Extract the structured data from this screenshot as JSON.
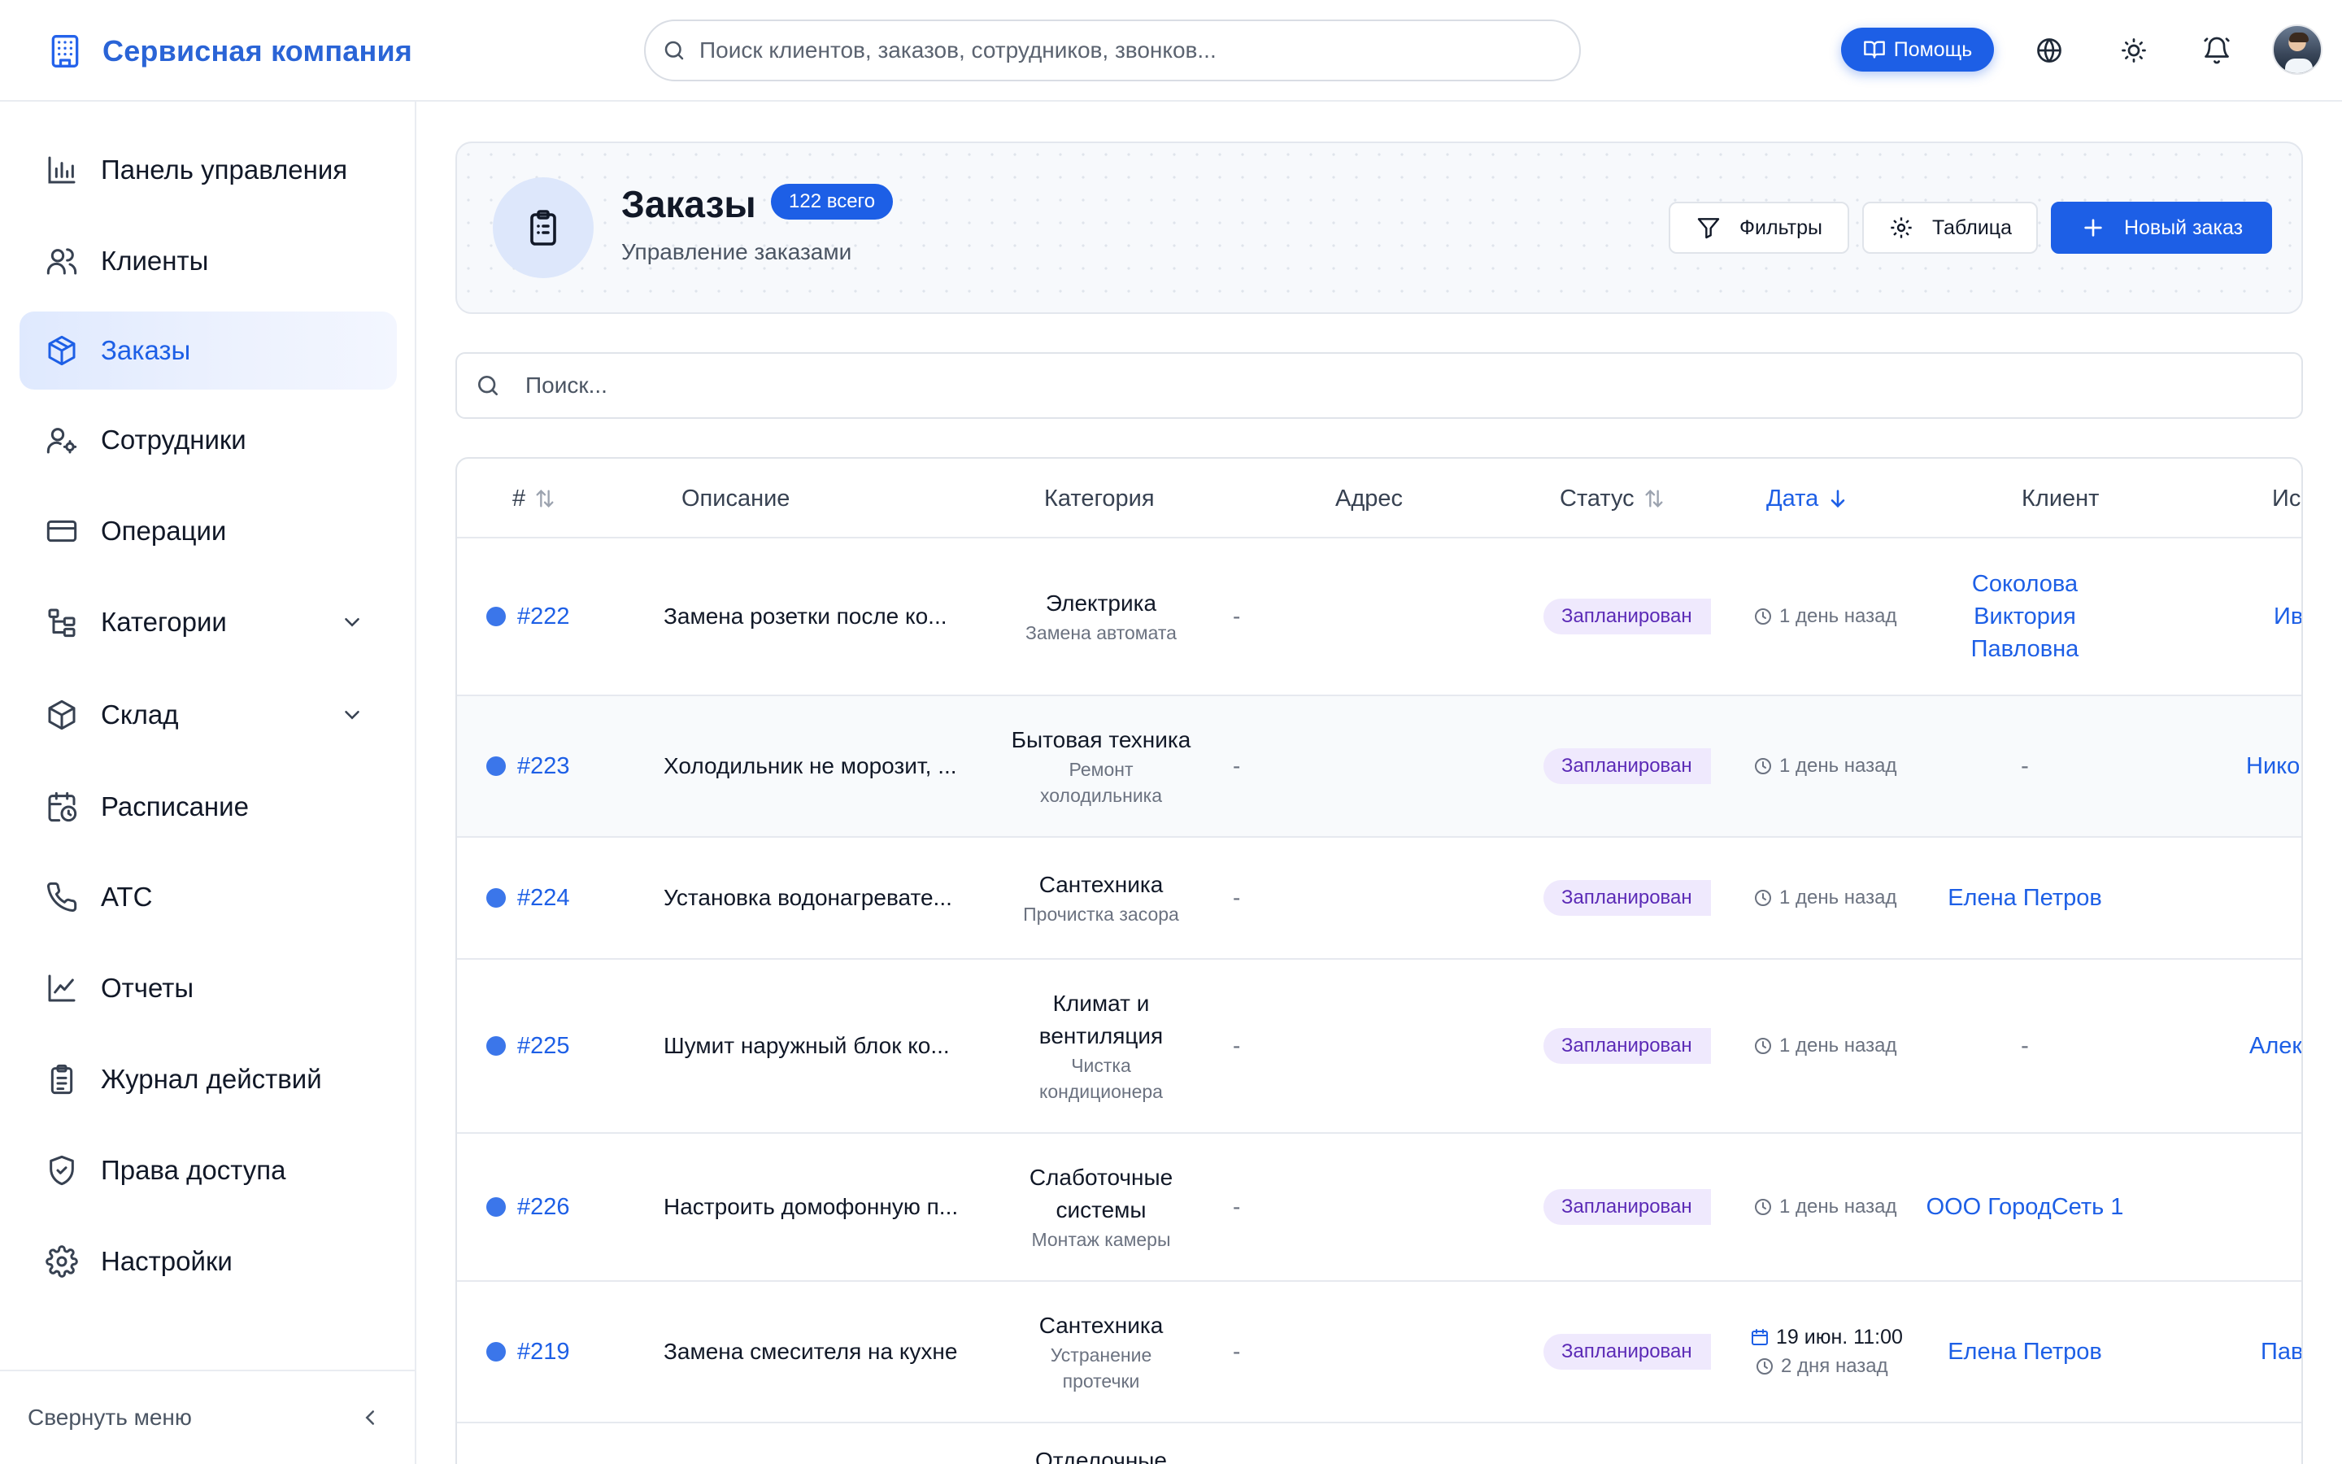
{
  "app": {
    "brand": "Сервисная компания",
    "search_placeholder": "Поиск клиентов, заказов, сотрудников, звонков...",
    "help_label": "Помощь",
    "accent": "#1d5fe6"
  },
  "sidebar": {
    "items": [
      {
        "label": "Панель управления",
        "icon": "bar-chart-icon"
      },
      {
        "label": "Клиенты",
        "icon": "users-icon"
      },
      {
        "label": "Заказы",
        "icon": "package-icon",
        "active": true
      },
      {
        "label": "Сотрудники",
        "icon": "user-cog-icon"
      },
      {
        "label": "Операции",
        "icon": "credit-card-icon"
      },
      {
        "label": "Категории",
        "icon": "hierarchy-icon",
        "expandable": true
      },
      {
        "label": "Склад",
        "icon": "box-icon",
        "expandable": true
      },
      {
        "label": "Расписание",
        "icon": "calendar-clock-icon"
      },
      {
        "label": "АТС",
        "icon": "phone-icon"
      },
      {
        "label": "Отчеты",
        "icon": "line-chart-icon"
      },
      {
        "label": "Журнал действий",
        "icon": "clipboard-icon"
      },
      {
        "label": "Права доступа",
        "icon": "shield-check-icon"
      },
      {
        "label": "Настройки",
        "icon": "gear-icon"
      }
    ],
    "collapse_label": "Свернуть меню"
  },
  "page": {
    "title": "Заказы",
    "count_badge": "122 всего",
    "subtitle": "Управление заказами",
    "filters_label": "Фильтры",
    "table_label": "Таблица",
    "new_order_label": "Новый заказ",
    "table_search_placeholder": "Поиск..."
  },
  "table": {
    "columns": [
      "#",
      "Описание",
      "Категория",
      "Адрес",
      "Статус",
      "Дата",
      "Клиент",
      "Ис"
    ],
    "rows": [
      {
        "id": "#222",
        "description": "Замена розетки после ко...",
        "category": "Электрика",
        "subcategory": "Замена автомата",
        "address": "-",
        "status": "Запланирован",
        "date": "",
        "relative": "1 день назад",
        "client": "Соколова Виктория Павловна",
        "executor": "Ив"
      },
      {
        "id": "#223",
        "description": "Холодильник не морозит, ...",
        "category": "Бытовая техника",
        "subcategory": "Ремонт холодильника",
        "address": "-",
        "status": "Запланирован",
        "date": "",
        "relative": "1 день назад",
        "client": "-",
        "executor": "Нико"
      },
      {
        "id": "#224",
        "description": "Установка водонагревате...",
        "category": "Сантехника",
        "subcategory": "Прочистка засора",
        "address": "-",
        "status": "Запланирован",
        "date": "",
        "relative": "1 день назад",
        "client": "Елена Петров",
        "executor": ""
      },
      {
        "id": "#225",
        "description": "Шумит наружный блок ко...",
        "category": "Климат и вентиляция",
        "subcategory": "Чистка кондиционера",
        "address": "-",
        "status": "Запланирован",
        "date": "",
        "relative": "1 день назад",
        "client": "-",
        "executor": "Алек"
      },
      {
        "id": "#226",
        "description": "Настроить домофонную п...",
        "category": "Слаботочные системы",
        "subcategory": "Монтаж камеры",
        "address": "-",
        "status": "Запланирован",
        "date": "",
        "relative": "1 день назад",
        "client": "ООО ГородСеть 1",
        "executor": ""
      },
      {
        "id": "#219",
        "description": "Замена смесителя на кухне",
        "category": "Сантехника",
        "subcategory": "Устранение протечки",
        "address": "-",
        "status": "Запланирован",
        "date": "19 июн. 11:00",
        "relative": "2 дня назад",
        "client": "Елена Петров",
        "executor": "Пав"
      },
      {
        "id": "",
        "description": "",
        "category": "Отделочные",
        "subcategory": "",
        "address": "",
        "status": "",
        "date": "",
        "relative": "",
        "client": "",
        "executor": ""
      }
    ]
  }
}
